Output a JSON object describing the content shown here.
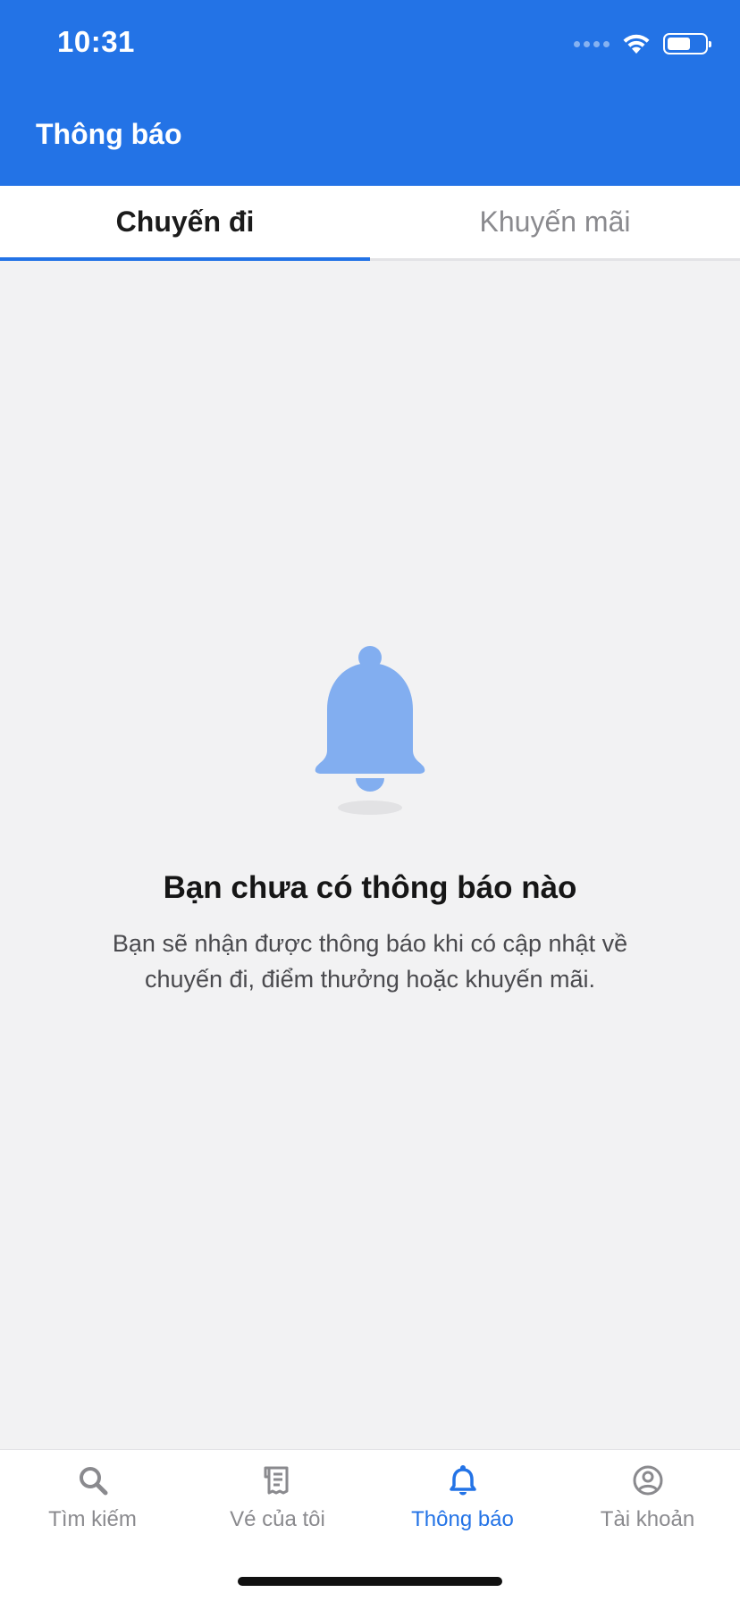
{
  "status_bar": {
    "time": "10:31"
  },
  "header": {
    "title": "Thông báo"
  },
  "tabs": [
    {
      "label": "Chuyến đi",
      "active": true
    },
    {
      "label": "Khuyến mãi",
      "active": false
    }
  ],
  "empty_state": {
    "icon": "bell-icon",
    "title": "Bạn chưa có thông báo nào",
    "description": "Bạn sẽ nhận được thông báo khi có cập nhật về chuyến đi, điểm thưởng hoặc khuyến mãi."
  },
  "bottom_nav": [
    {
      "label": "Tìm kiếm",
      "icon": "search-icon",
      "active": false
    },
    {
      "label": "Vé của tôi",
      "icon": "ticket-icon",
      "active": false
    },
    {
      "label": "Thông báo",
      "icon": "bell-icon",
      "active": true
    },
    {
      "label": "Tài khoản",
      "icon": "account-icon",
      "active": false
    }
  ],
  "colors": {
    "primary": "#2373e6",
    "bell_illustration": "#82aef0",
    "background": "#f2f2f3",
    "inactive": "#8a8a8e"
  }
}
